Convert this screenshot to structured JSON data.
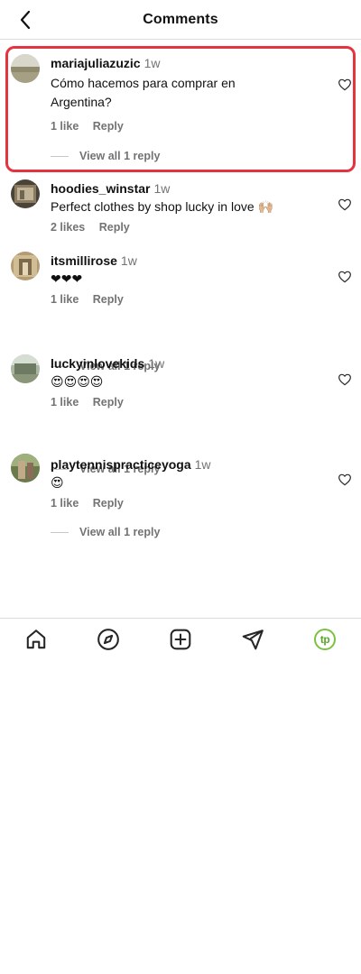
{
  "header": {
    "title": "Comments"
  },
  "comments": [
    {
      "username": "mariajuliazuzic",
      "time": "1w",
      "text_line1": "Cómo hacemos para comprar en",
      "text_line2": "Argentina?",
      "likes": "1 like",
      "reply": "Reply",
      "view_replies": "View all 1 reply"
    },
    {
      "username": "hoodies_winstar",
      "time": "1w",
      "text": "Perfect clothes by shop lucky in love 🙌🏼",
      "likes": "2 likes",
      "reply": "Reply"
    },
    {
      "username": "itsmillirose",
      "time": "1w",
      "text": "❤❤❤",
      "likes": "1 like",
      "reply": "Reply",
      "view_replies": "View all 1 reply"
    },
    {
      "username": "luckyinlovekids",
      "time": "1w",
      "text": "😍😍😍😍",
      "likes": "1 like",
      "reply": "Reply",
      "view_replies": "View all 1 reply"
    },
    {
      "username": "playtennispracticeyoga",
      "time": "1w",
      "text": "😍",
      "likes": "1 like",
      "reply": "Reply",
      "view_replies": "View all 1 reply"
    }
  ],
  "nav": {
    "icons": [
      "home-icon",
      "explore-icon",
      "create-icon",
      "direct-icon",
      "profile-icon"
    ],
    "profile_initials": "tp"
  },
  "colors": {
    "highlight": "#e3343f",
    "muted": "#737373",
    "profile_ring": "#7cc242"
  }
}
